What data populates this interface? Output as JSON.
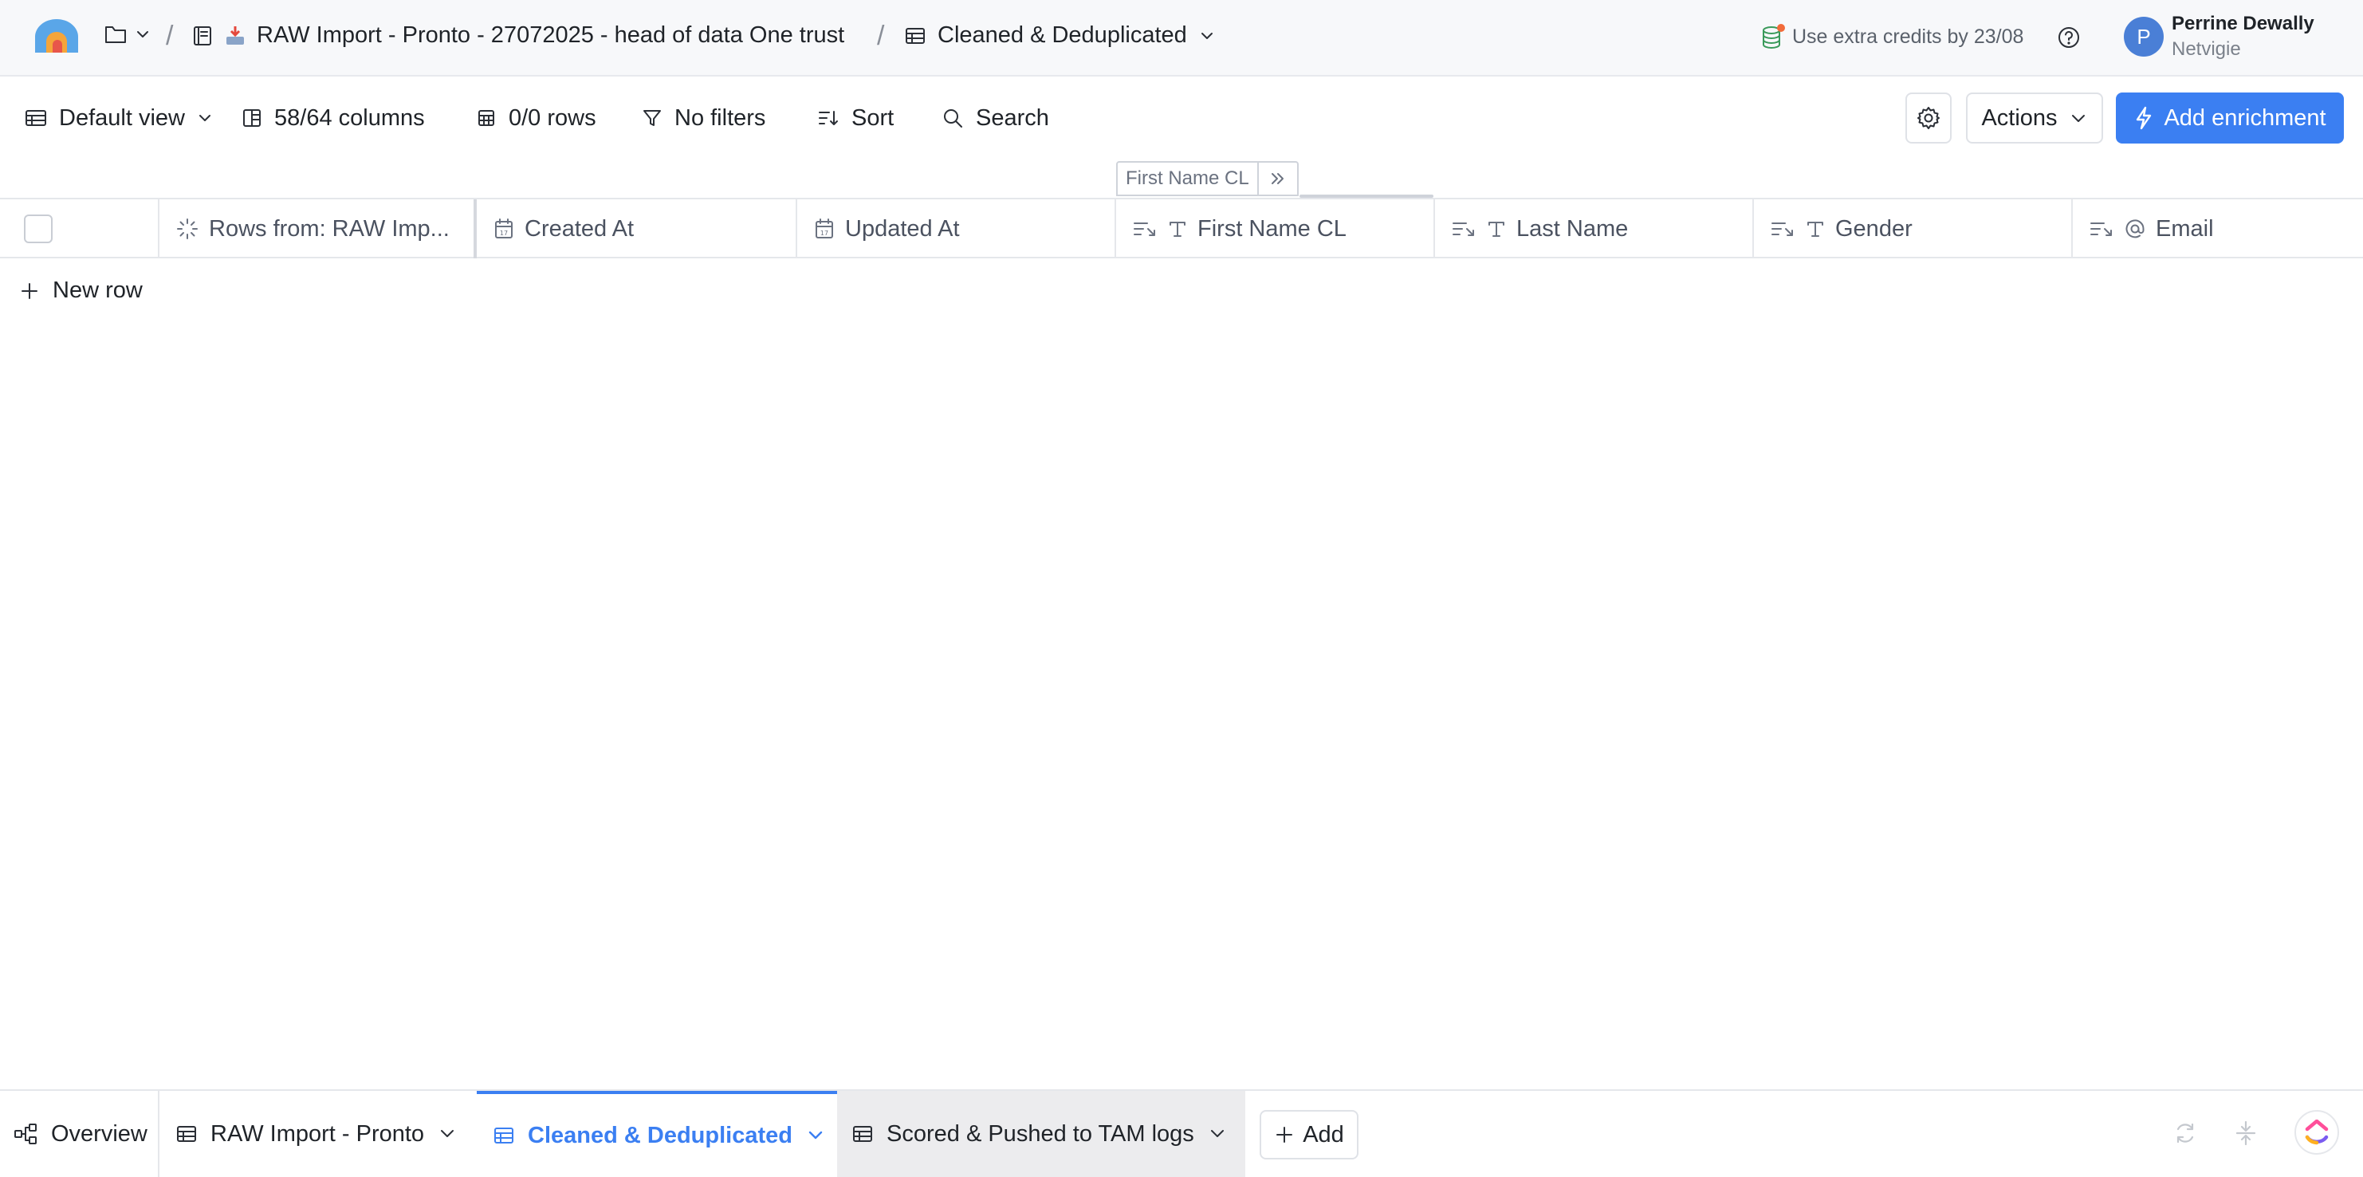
{
  "header": {
    "project_name": "RAW Import - Pronto - 27072025 - head of data One trust",
    "current_table": "Cleaned & Deduplicated",
    "credits_notice": "Use extra credits by 23/08",
    "user": {
      "initial": "P",
      "name": "Perrine Dewally",
      "org": "Netvigie"
    }
  },
  "toolbar": {
    "view_label": "Default view",
    "columns_label": "58/64 columns",
    "rows_label": "0/0 rows",
    "filters_label": "No filters",
    "sort_label": "Sort",
    "search_label": "Search",
    "actions_label": "Actions",
    "add_enrichment_label": "Add enrichment"
  },
  "grid": {
    "tooltip_label": "First Name CL",
    "columns": [
      {
        "label": "Rows from: RAW Imp...",
        "icon": "loading-icon"
      },
      {
        "label": "Created At",
        "icon": "calendar-icon"
      },
      {
        "label": "Updated At",
        "icon": "calendar-icon"
      },
      {
        "label": "First Name CL",
        "icon": "text-icon"
      },
      {
        "label": "Last Name",
        "icon": "text-icon"
      },
      {
        "label": "Gender",
        "icon": "text-icon"
      },
      {
        "label": "Email",
        "icon": "at-icon"
      }
    ],
    "new_row_label": "New row"
  },
  "bottom_tabs": {
    "overview": "Overview",
    "tables": [
      {
        "label": "RAW Import - Pronto",
        "state": "normal"
      },
      {
        "label": "Cleaned & Deduplicated",
        "state": "active"
      },
      {
        "label": "Scored & Pushed to TAM logs",
        "state": "hover"
      }
    ],
    "add_label": "Add"
  },
  "colors": {
    "accent": "#3b7ff2",
    "avatar": "#4a7fd6",
    "text": "#1f2328",
    "muted": "#4b5260",
    "border": "#e5e7eb"
  }
}
